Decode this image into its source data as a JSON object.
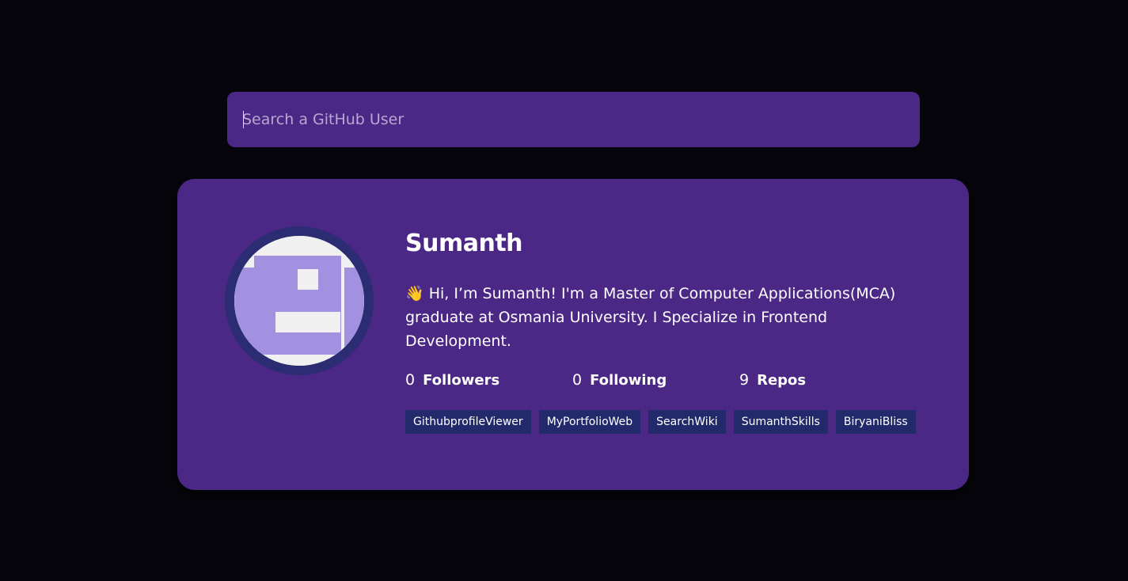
{
  "search": {
    "placeholder": "Search a GitHub User",
    "value": ""
  },
  "profile": {
    "name": "Sumanth",
    "avatar_icon": "identicon-avatar",
    "bio": "👋 Hi, I’m Sumanth! I'm a Master of Computer Applications(MCA) graduate at Osmania University. I Specialize in Frontend Development.",
    "stats": [
      {
        "value": "0",
        "label": "Followers"
      },
      {
        "value": "0",
        "label": "Following"
      },
      {
        "value": "9",
        "label": "Repos"
      }
    ],
    "repos": [
      "GithubprofileViewer",
      "MyPortfolioWeb",
      "SearchWiki",
      "SumanthSkills",
      "BiryaniBliss"
    ]
  },
  "colors": {
    "background": "#05050b",
    "card": "#4b2885",
    "avatar_ring": "#2b2c72",
    "repo_chip": "#232a6c",
    "identicon": "#a291e1"
  }
}
